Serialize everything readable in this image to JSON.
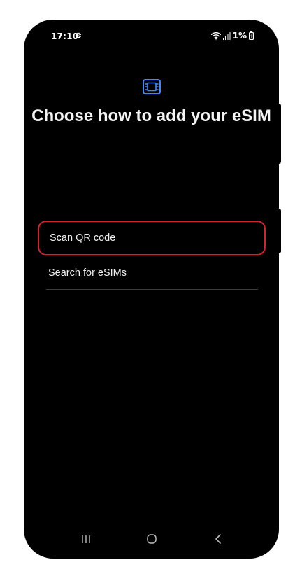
{
  "status_bar": {
    "time": "17:10",
    "battery": "1%"
  },
  "screen": {
    "title": "Choose how to add your eSIM",
    "options": [
      {
        "label": "Scan QR code",
        "highlighted": true
      },
      {
        "label": "Search for eSIMs",
        "highlighted": false
      }
    ]
  },
  "icons": {
    "settings": "gear-icon",
    "wifi": "wifi-icon",
    "signal": "signal-icon",
    "battery": "battery-icon",
    "esim": "esim-icon",
    "recents": "recents-icon",
    "home": "home-icon",
    "back": "back-icon"
  },
  "colors": {
    "accent": "#3d8bff",
    "highlight": "#d8212d",
    "background": "#000000"
  }
}
